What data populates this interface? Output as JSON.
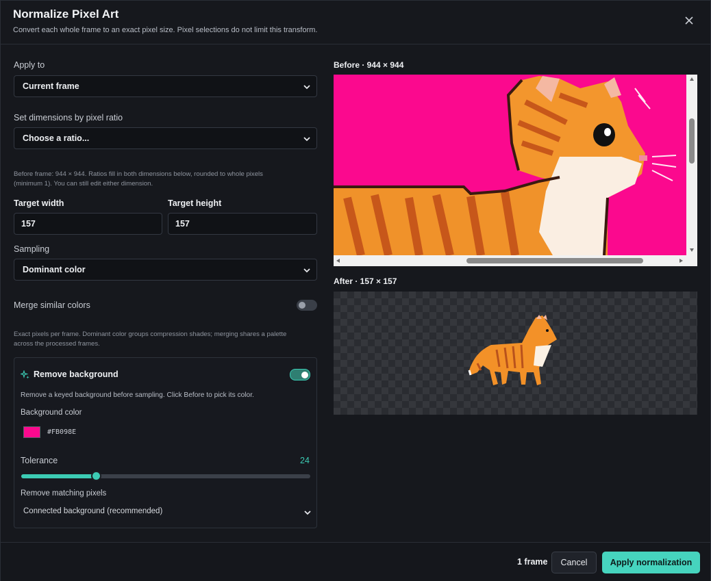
{
  "header": {
    "title": "Normalize Pixel Art",
    "subtitle": "Convert each whole frame to an exact pixel size. Pixel selections do not limit this transform.",
    "close_icon": "close-icon"
  },
  "form": {
    "apply_to": {
      "label": "Apply to",
      "value": "Current frame"
    },
    "ratio": {
      "label": "Set dimensions by pixel ratio",
      "value": "Choose a ratio..."
    },
    "ratio_note_1": "Before frame: 944 × 944. Ratios fill in both dimensions below, rounded to whole pixels",
    "ratio_note_2": "(minimum 1). You can still edit either dimension.",
    "target_width": {
      "label": "Target width",
      "value": "157"
    },
    "target_height": {
      "label": "Target height",
      "value": "157"
    },
    "sampling": {
      "label": "Sampling",
      "value": "Dominant color"
    },
    "merge": {
      "label": "Merge similar colors",
      "enabled": false
    },
    "merge_note_1": "Exact pixels per frame. Dominant color groups compression shades; merging shares a palette",
    "merge_note_2": "across the processed frames."
  },
  "remove_background": {
    "title": "Remove background",
    "icon": "sparkles-icon",
    "enabled": true,
    "description": "Remove a keyed background before sampling. Click Before to pick its color.",
    "color_label": "Background color",
    "color_hex": "#FB098E",
    "swatch_color": "#fb098e",
    "tolerance_label": "Tolerance",
    "tolerance_value": "24",
    "tolerance_fraction": 0.26,
    "match_label": "Remove matching pixels",
    "match_value": "Connected background (recommended)"
  },
  "preview": {
    "before_label": "Before · 944 × 944",
    "after_label": "After · 157 × 157"
  },
  "footer": {
    "frame_count": "1 frame",
    "cancel_label": "Cancel",
    "apply_label": "Apply normalization"
  },
  "colors": {
    "accent": "#46d4be",
    "key_magenta": "#fb098e"
  }
}
